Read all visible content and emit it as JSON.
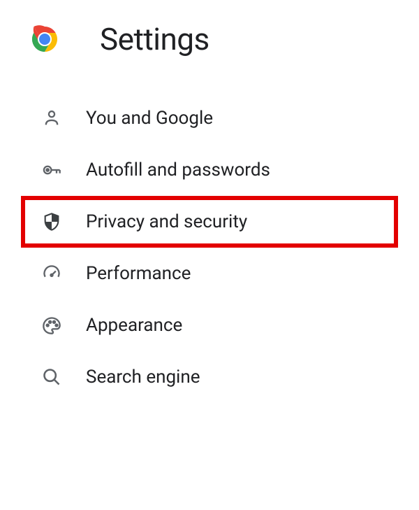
{
  "header": {
    "title": "Settings"
  },
  "menu": {
    "items": [
      {
        "icon": "person-icon",
        "label": "You and Google",
        "highlighted": false
      },
      {
        "icon": "key-icon",
        "label": "Autofill and passwords",
        "highlighted": false
      },
      {
        "icon": "shield-icon",
        "label": "Privacy and security",
        "highlighted": true
      },
      {
        "icon": "speedometer-icon",
        "label": "Performance",
        "highlighted": false
      },
      {
        "icon": "palette-icon",
        "label": "Appearance",
        "highlighted": false
      },
      {
        "icon": "search-icon",
        "label": "Search engine",
        "highlighted": false
      }
    ]
  },
  "annotation": {
    "highlight_color": "#e30000"
  }
}
